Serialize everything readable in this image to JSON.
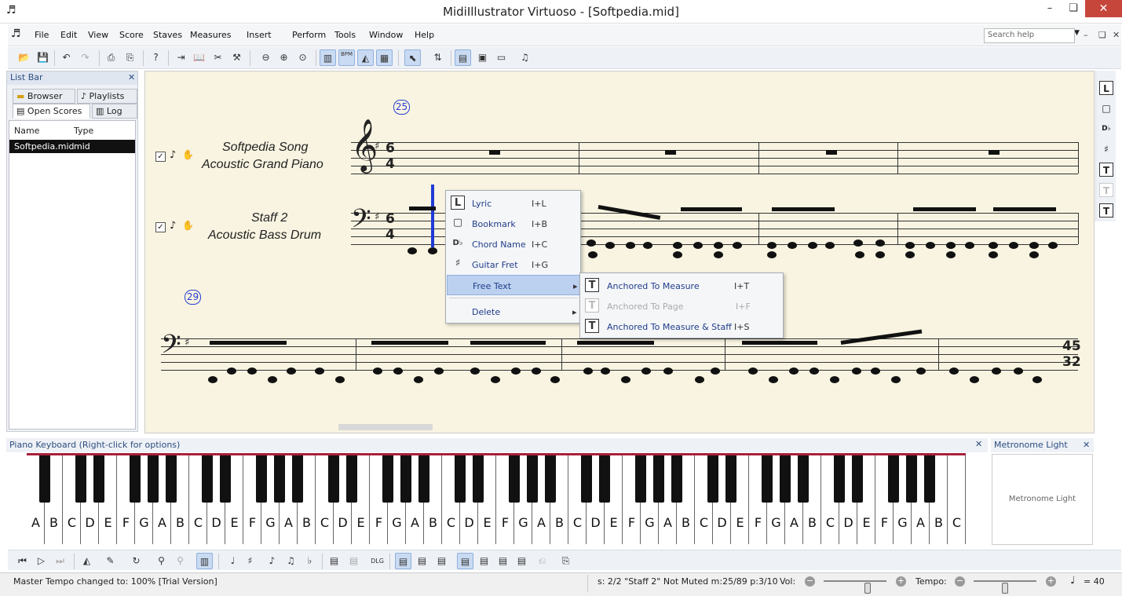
{
  "app": {
    "title": "MidiIllustrator Virtuoso - [Softpedia.mid]"
  },
  "window_controls": {
    "minimize": "–",
    "restore": "❏",
    "close": "✕"
  },
  "menu": {
    "items": [
      "File",
      "Edit",
      "View",
      "Score",
      "Staves",
      "Measures",
      "Insert",
      "Perform",
      "Tools",
      "Window",
      "Help"
    ],
    "search_placeholder": "Search help",
    "mdi_controls": [
      "–",
      "❏",
      "✕"
    ]
  },
  "toolbar": {
    "buttons": [
      "open-icon",
      "save-icon",
      "undo-icon",
      "redo-icon",
      "print-icon",
      "print-preview-icon",
      "help-icon",
      "export-icon",
      "book-icon",
      "tools-icon",
      "settings-icon",
      "zoom-out-icon",
      "zoom-in-icon",
      "zoom-fit-icon",
      "keyboard-icon",
      "bpm-icon",
      "metronome-icon",
      "mixer-icon",
      "select-tool-icon",
      "swap-icon",
      "page-view-icon",
      "single-view-icon",
      "window-view-icon",
      "score-settings-icon"
    ],
    "bpm_label": "BPM"
  },
  "list_bar": {
    "title": "List Bar",
    "tabs": [
      "Browser",
      "Playlists",
      "Open Scores",
      "Log"
    ],
    "active_tab": "Open Scores",
    "columns": [
      "Name",
      "Type"
    ],
    "rows": [
      {
        "name": "Softpedia.mid",
        "type": "mid"
      }
    ]
  },
  "score": {
    "measure_number_top": "25",
    "measure_number_bottom": "29",
    "staff1": {
      "name": "Softpedia Song",
      "instrument": "Acoustic Grand Piano"
    },
    "staff2": {
      "name": "Staff 2",
      "instrument": "Acoustic Bass Drum"
    },
    "time_signature": {
      "top": "6",
      "bottom": "4"
    },
    "end_time_signature": {
      "top": "45",
      "bottom": "32"
    }
  },
  "context_menu": {
    "items": [
      {
        "label": "Lyric",
        "shortcut": "I+L",
        "icon": "lyric-icon"
      },
      {
        "label": "Bookmark",
        "shortcut": "I+B",
        "icon": "bookmark-icon"
      },
      {
        "label": "Chord Name",
        "shortcut": "I+C",
        "icon": "chord-name-icon"
      },
      {
        "label": "Guitar Fret",
        "shortcut": "I+G",
        "icon": "guitar-fret-icon"
      },
      {
        "label": "Free Text",
        "shortcut": "▸",
        "icon": ""
      },
      {
        "label": "Delete",
        "shortcut": "▸",
        "icon": ""
      }
    ]
  },
  "submenu": {
    "items": [
      {
        "label": "Anchored To Measure",
        "shortcut": "I+T",
        "disabled": false
      },
      {
        "label": "Anchored To Page",
        "shortcut": "I+F",
        "disabled": true
      },
      {
        "label": "Anchored To Measure & Staff",
        "shortcut": "I+S",
        "disabled": false
      }
    ]
  },
  "right_toolbar": [
    "L",
    "□",
    "D♭",
    "♯",
    "T",
    "T",
    "T"
  ],
  "piano": {
    "title": "Piano Keyboard (Right-click for options)",
    "keys": [
      "A",
      "B",
      "C",
      "D",
      "E",
      "F",
      "G",
      "A",
      "B",
      "C",
      "D",
      "E",
      "F",
      "G",
      "A",
      "B",
      "C",
      "D",
      "E",
      "F",
      "G",
      "A",
      "B",
      "C",
      "D",
      "E",
      "F",
      "G",
      "A",
      "B",
      "C",
      "D",
      "E",
      "F",
      "G",
      "A",
      "B",
      "C",
      "D",
      "E",
      "F",
      "G",
      "A",
      "B",
      "C",
      "D",
      "E",
      "F",
      "G",
      "A",
      "B",
      "C"
    ]
  },
  "metronome": {
    "title": "Metronome Light",
    "label": "Metronome Light"
  },
  "status": {
    "message": "Master Tempo changed to: 100%  [Trial Version]",
    "info": "s: 2/2 \"Staff 2\" Not Muted  m:25/89  p:3/10",
    "vol_label": "Vol:",
    "tempo_label": "Tempo:",
    "tempo_value": "= 40",
    "vol_level": 0.72,
    "tempo_level": 0.5
  },
  "colors": {
    "accent": "#1f3d8a",
    "piano_top": "#a8213a",
    "selection_cursor": "#1f3cd6",
    "score_bg": "#f8f4e1"
  }
}
